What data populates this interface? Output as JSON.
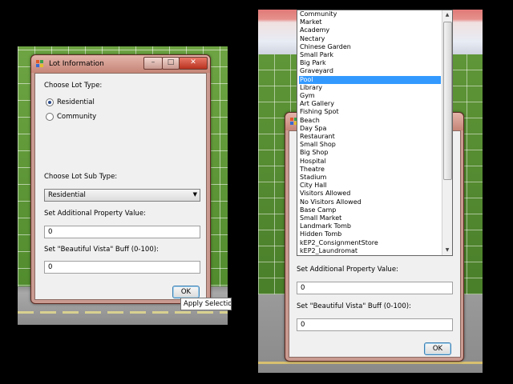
{
  "left_dialog": {
    "title": "Lot Information",
    "choose_lot_type_label": "Choose Lot Type:",
    "lot_types": [
      {
        "label": "Residential",
        "selected": true
      },
      {
        "label": "Community",
        "selected": false
      }
    ],
    "choose_sub_type_label": "Choose Lot Sub Type:",
    "sub_type_value": "Residential",
    "additional_value_label": "Set Additional Property Value:",
    "additional_value": "0",
    "vista_label": "Set \"Beautiful Vista\" Buff (0-100):",
    "vista_value": "0",
    "ok_label": "OK",
    "tooltip": "Apply Selection"
  },
  "right_dialog": {
    "additional_value_label": "Set Additional Property Value:",
    "additional_value": "0",
    "vista_label": "Set \"Beautiful Vista\" Buff (0-100):",
    "vista_value": "0",
    "ok_label": "OK",
    "dropdown_items": [
      "Community",
      "Market",
      "Academy",
      "Nectary",
      "Chinese Garden",
      "Small Park",
      "Big Park",
      "Graveyard",
      "Pool",
      "Library",
      "Gym",
      "Art Gallery",
      "Fishing Spot",
      "Beach",
      "Day Spa",
      "Restaurant",
      "Small Shop",
      "Big Shop",
      "Hospital",
      "Theatre",
      "Stadium",
      "City Hall",
      "Visitors Allowed",
      "No Visitors Allowed",
      "Base Camp",
      "Small Market",
      "Landmark Tomb",
      "Hidden Tomb",
      "kEP2_ConsignmentStore",
      "kEP2_Laundromat"
    ],
    "dropdown_selected": "Pool"
  },
  "colors": {
    "selection": "#3399ff",
    "title_bar": "#c58576",
    "close_button": "#b8321e"
  }
}
